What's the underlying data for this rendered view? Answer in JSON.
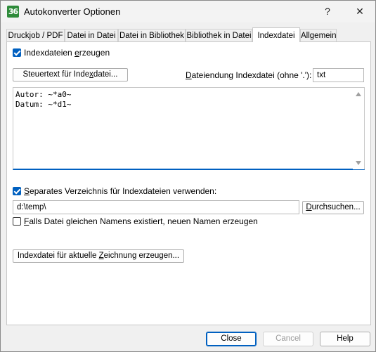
{
  "window": {
    "title": "Autokonverter Optionen",
    "app_icon_text": "36",
    "help_glyph": "?",
    "close_glyph": "✕"
  },
  "tabs": [
    {
      "label": "Druckjob / PDF"
    },
    {
      "label": "Datei in Datei"
    },
    {
      "label": "Datei in Bibliothek"
    },
    {
      "label": "Bibliothek in Datei"
    },
    {
      "label": "Indexdatei"
    },
    {
      "label": "Allgemein"
    }
  ],
  "active_tab": "Indexdatei",
  "index": {
    "create_checkbox": {
      "label_pre": "Indexdateien ",
      "label_ul": "e",
      "label_post": "rzeugen",
      "checked": true
    },
    "steuertext_button": {
      "pre": "Steuertext für Inde",
      "ul": "x",
      "post": "datei..."
    },
    "extension_label": {
      "ul": "D",
      "post": "ateiendung Indexdatei (ohne '.'):"
    },
    "extension_value": "txt",
    "template_lines": [
      "Autor: ~*a0~",
      "Datum: ~*d1~"
    ],
    "separate_dir_checkbox": {
      "label_pre": "",
      "label_ul": "S",
      "label_post": "eparates Verzeichnis für Indexdateien verwenden:",
      "checked": true
    },
    "directory_value": "d:\\temp\\",
    "browse_button": {
      "ul": "D",
      "post": "urchsuchen..."
    },
    "new_name_checkbox": {
      "label_pre": "",
      "label_ul": "F",
      "label_post": "alls Datei gleichen Namens existiert, neuen Namen erzeugen",
      "checked": false
    },
    "generate_button": {
      "pre": "Indexdatei für aktuelle ",
      "ul": "Z",
      "post": "eichnung erzeugen..."
    }
  },
  "buttons": {
    "close": "Close",
    "cancel": "Cancel",
    "help": "Help"
  },
  "colors": {
    "accent": "#0060c0",
    "app_icon": "#2e8b3a"
  }
}
